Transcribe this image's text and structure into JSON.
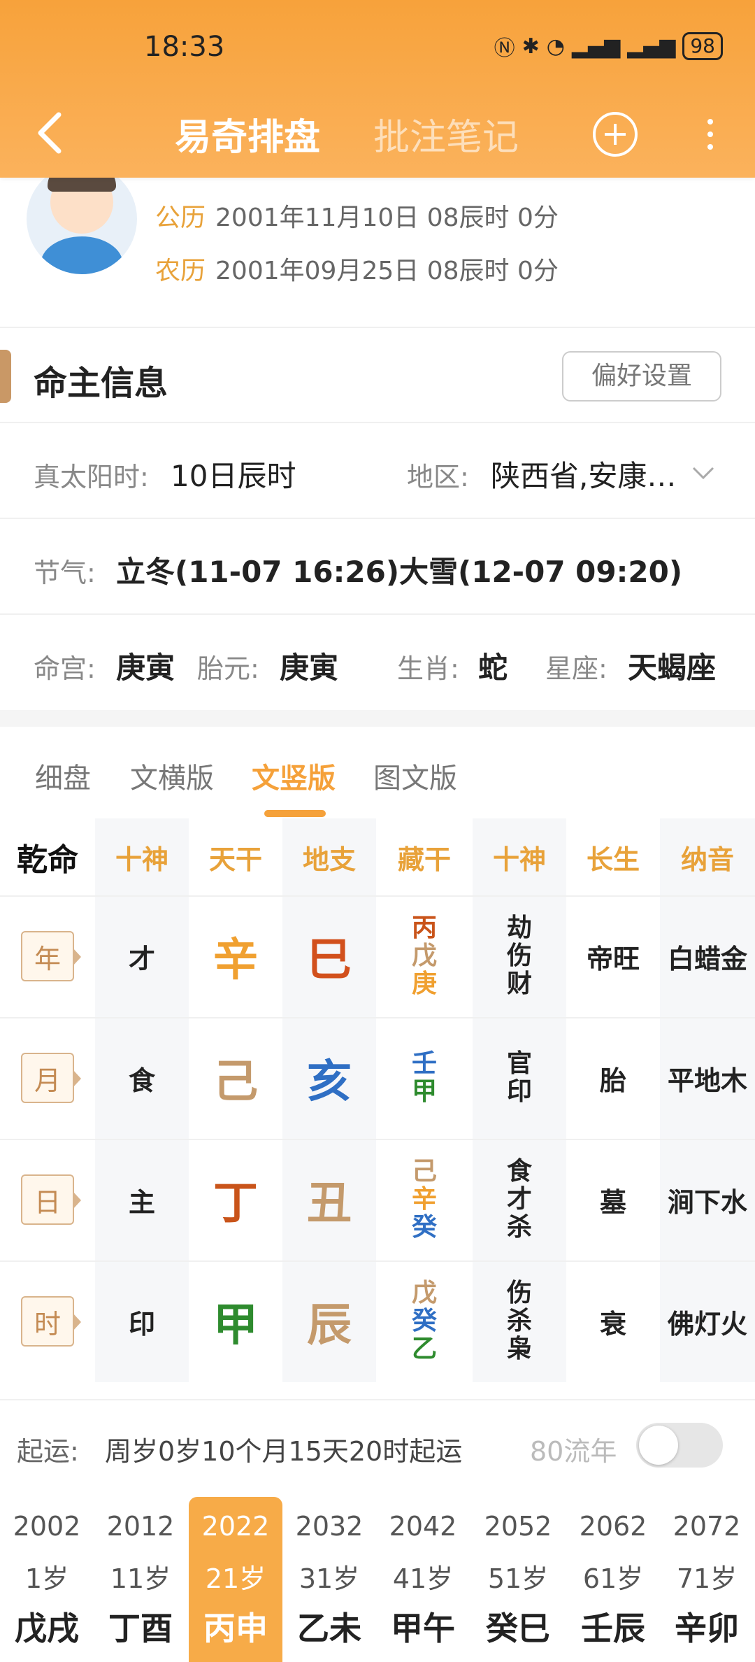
{
  "status": {
    "time": "18:33",
    "battery": "98"
  },
  "nav": {
    "title": "易奇排盘",
    "notes_tab": "批注笔记"
  },
  "profile": {
    "solar_label": "公历",
    "solar_value": "2001年11月10日 08辰时 0分",
    "lunar_label": "农历",
    "lunar_value": "2001年09月25日 08辰时 0分"
  },
  "section": {
    "title": "命主信息",
    "pref_button": "偏好设置"
  },
  "info": {
    "true_solar_label": "真太阳时:",
    "true_solar_value": "10日辰时",
    "region_label": "地区:",
    "region_value": "陕西省,安康…",
    "jieqi_label": "节气:",
    "jieqi_value": "立冬(11-07 16:26)大雪(12-07 09:20)",
    "minggong_label": "命宫:",
    "minggong_value": "庚寅",
    "taiyuan_label": "胎元:",
    "taiyuan_value": "庚寅",
    "shengxiao_label": "生肖:",
    "shengxiao_value": "蛇",
    "xingzuo_label": "星座:",
    "xingzuo_value": "天蝎座"
  },
  "view_tabs": [
    "细盘",
    "文横版",
    "文竖版",
    "图文版"
  ],
  "view_tab_active": "文竖版",
  "table": {
    "corner": "乾命",
    "headers": [
      "十神",
      "天干",
      "地支",
      "藏干",
      "十神",
      "长生",
      "纳音"
    ],
    "rows": [
      {
        "label": "年",
        "shishen": "才",
        "tiangan": "辛",
        "dizhi": "巳",
        "canggan": [
          "丙",
          "戊",
          "庚"
        ],
        "canggan_shishen": [
          "劫",
          "伤",
          "财"
        ],
        "changsheng": "帝旺",
        "nayin": "白蜡金"
      },
      {
        "label": "月",
        "shishen": "食",
        "tiangan": "己",
        "dizhi": "亥",
        "canggan": [
          "壬",
          "甲"
        ],
        "canggan_shishen": [
          "官",
          "印"
        ],
        "changsheng": "胎",
        "nayin": "平地木"
      },
      {
        "label": "日",
        "shishen": "主",
        "tiangan": "丁",
        "dizhi": "丑",
        "canggan": [
          "己",
          "辛",
          "癸"
        ],
        "canggan_shishen": [
          "食",
          "才",
          "杀"
        ],
        "changsheng": "墓",
        "nayin": "涧下水"
      },
      {
        "label": "时",
        "shishen": "印",
        "tiangan": "甲",
        "dizhi": "辰",
        "canggan": [
          "戊",
          "癸",
          "乙"
        ],
        "canggan_shishen": [
          "伤",
          "杀",
          "枭"
        ],
        "changsheng": "衰",
        "nayin": "佛灯火"
      }
    ]
  },
  "colors": {
    "fire": "#c9541a",
    "earth": "#c49a6c",
    "water": "#2f6fc4",
    "wood": "#2e8b2e",
    "metal": "#f0a030",
    "accent": "#f5a13a"
  },
  "qiyun": {
    "label": "起运:",
    "text": "周岁0岁10个月15天20时起运",
    "liunian": "80流年"
  },
  "dayun": [
    {
      "year": "2002",
      "age": "1岁",
      "gz": "戊戌"
    },
    {
      "year": "2012",
      "age": "11岁",
      "gz": "丁酉"
    },
    {
      "year": "2022",
      "age": "21岁",
      "gz": "丙申",
      "active": true
    },
    {
      "year": "2032",
      "age": "31岁",
      "gz": "乙未"
    },
    {
      "year": "2042",
      "age": "41岁",
      "gz": "甲午"
    },
    {
      "year": "2052",
      "age": "51岁",
      "gz": "癸巳"
    },
    {
      "year": "2062",
      "age": "61岁",
      "gz": "壬辰"
    },
    {
      "year": "2072",
      "age": "71岁",
      "gz": "辛卯"
    }
  ]
}
